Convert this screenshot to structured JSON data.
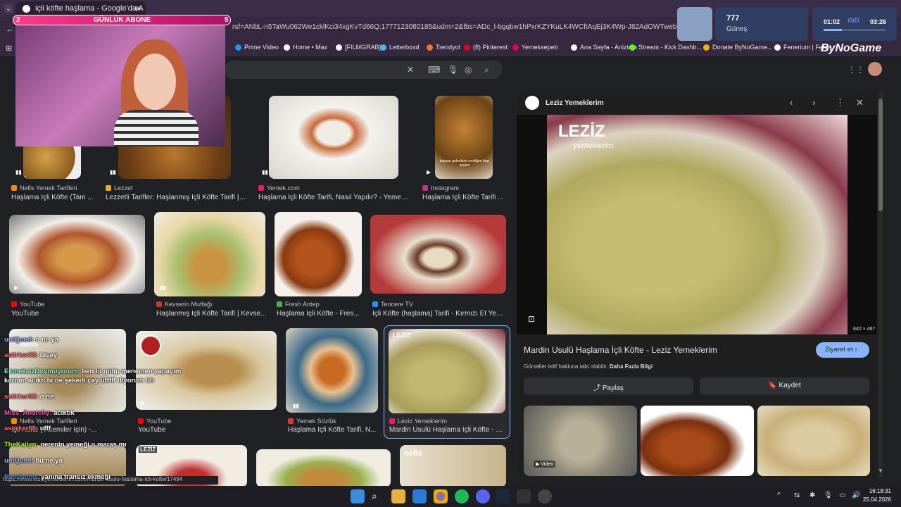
{
  "browser": {
    "tab_title": "içli köfte haşlama - Google'da A",
    "address": "rsf=ANbL-n5TaWu062We1cklKci34xgKvTd66Q:1777123080185&udm=2&fbs=ADc_l-bgqbw1hPxrKZYKuLK4WCftAqEj3K4Wp-J82AdOWTwebDW-skANg3fMg",
    "bookmarks": [
      {
        "label": "Prime Video",
        "color": "#1a98ff"
      },
      {
        "label": "Home • Max",
        "color": "#ffffff"
      },
      {
        "label": "[FILMGRAB]",
        "color": "#ffffff"
      },
      {
        "label": "Letterboxd",
        "color": "#40bcf4"
      },
      {
        "label": "Trendyol",
        "color": "#f27a1a"
      },
      {
        "label": "(8) Pinterest",
        "color": "#e60023"
      },
      {
        "label": "Yemeksepeti",
        "color": "#ea004b"
      },
      {
        "label": "Ana Sayfa - Anizium",
        "color": "#ffffff"
      },
      {
        "label": "Stream - Kick Dashb...",
        "color": "#53fc18"
      },
      {
        "label": "Donate ByNoGame...",
        "color": "#f5b400"
      },
      {
        "label": "Fenerium | Fene",
        "color": "#ffffff"
      }
    ],
    "logo": "ByNoGame"
  },
  "stream": {
    "sub_goal_left": "2",
    "sub_goal_label": "GÜNLÜK ABONE",
    "sub_goal_right": "5",
    "weather_temp": "777",
    "weather_label": "Güneş",
    "music_elapsed": "01:02",
    "music_total": "03:26",
    "chat": [
      {
        "user": "uniQued:",
        "msg": "o ne ya",
        "color": "#9ab0ff"
      },
      {
        "user": "astirker68:",
        "msg": "bişey",
        "color": "#ff6b6b"
      },
      {
        "user": "EkmeksizDoymuyorum:",
        "msg": "ben bi gidip menemen yapayım",
        "color": "#7fffd4"
      },
      {
        "user": "",
        "msg": "karnım acıktı bi de şekerli çay üfffff diyorum bb",
        "color": "#ffffff"
      },
      {
        "user": "astirker68:",
        "msg": "o ne",
        "color": "#ff6b6b"
      },
      {
        "user": "Miss_Anarchy:",
        "msg": "acıktık",
        "color": "#ff4fb0"
      },
      {
        "user": "astirker68:",
        "msg": "ufff",
        "color": "#ff6b6b"
      },
      {
        "user": "TheKailyn:",
        "msg": "nerenin yemeği o maraş mı",
        "color": "#b6ff00"
      },
      {
        "user": "uniQued:",
        "msg": "bu ne ya",
        "color": "#9ab0ff"
      },
      {
        "user": "Rendsonn:",
        "msg": "yanına fransız ekmeği",
        "color": "#6495ed"
      }
    ]
  },
  "results": {
    "row1": [
      {
        "source": "Nefis Yemek Tarifleri",
        "title": "Haşlama İçli Köfte (Tam ...",
        "color": "#ff8a00"
      },
      {
        "source": "Lezzet",
        "title": "Lezzetli Tarifler: Haşlanmış İçli Köfte Tarifi | ...",
        "color": "#f5a623"
      },
      {
        "source": "Yemek.com",
        "title": "Haşlama İçli Köfte Tarifi, Nasıl Yapılır? - Yemek...",
        "color": "#e91e63"
      },
      {
        "source": "Instagram",
        "title": "Haşlama İçli Köfte Tarifi ...",
        "color": "#c13584"
      }
    ],
    "row1_caption": "başıma gelenlerle rendiğim bazı şeyleri",
    "row2": [
      {
        "source": "YouTube",
        "title": "YouTube",
        "color": "#ff0000"
      },
      {
        "source": "Kevserin Mutfağı",
        "title": "Haşlanmış İçli Köfte Tarifi | Kevse...",
        "color": "#d32f2f"
      },
      {
        "source": "Fresh Antep",
        "title": "Haşlama İçli Köfte - Fres...",
        "color": "#4caf50"
      },
      {
        "source": "Tencere TV",
        "title": "İçli Köfte (haşlama) Tarifi - Kırmızı Et Yem...",
        "color": "#2196f3"
      }
    ],
    "row3": [
      {
        "source": "Nefis Yemek Tarifleri",
        "title": "İçli Köfte ( Acemiler İçin) -...",
        "color": "#ff8a00"
      },
      {
        "source": "YouTube",
        "title": "YouTube",
        "color": "#ff0000"
      },
      {
        "source": "Yemek Sözlük",
        "title": "Haşlama İçli Köfte Tarifi, N...",
        "color": "#e53935"
      },
      {
        "source": "Leziz Yemeklerim",
        "title": "Mardin Usulü Haşlama İçli Köfte - L...",
        "color": "#e91e63"
      }
    ],
    "overlay_labels": {
      "nefis": "nefis",
      "leziz": "LEZİZ",
      "lezize": "LEZİZ",
      "nefis2": "nefis"
    },
    "status_url": "https://www.lezizyemeklerim.com/mardin-usulu-haslama-icli-kofte/17494"
  },
  "panel": {
    "site": "Leziz Yemeklerim",
    "image_watermark_big": "LEZİZ",
    "image_watermark_small": "yemeklerim",
    "image_size": "640 × 467",
    "title": "Mardin Usulü Haşlama İçli Köfte - Leziz Yemeklerim",
    "visit_label": "Ziyaret et",
    "copyright": "Görseller telif hakkına tabi olabilir.",
    "more_info": "Daha Fazla Bilgi",
    "share_label": "Paylaş",
    "save_label": "Kaydet",
    "video_label": "Video"
  },
  "taskbar": {
    "time": "16:18:31",
    "date": "25.04.2026"
  }
}
